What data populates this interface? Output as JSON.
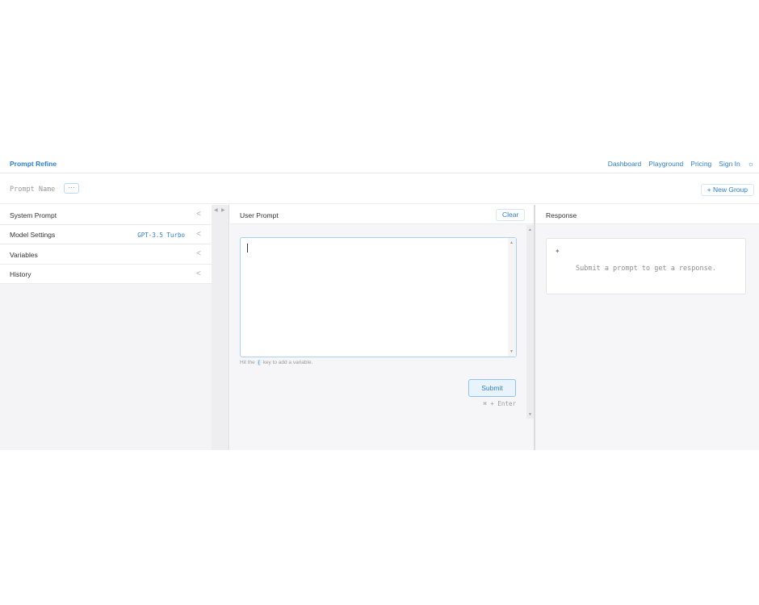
{
  "header": {
    "brand": "Prompt Refine",
    "nav": [
      "Dashboard",
      "Playground",
      "Pricing",
      "Sign In"
    ],
    "theme_icon": "sun-icon"
  },
  "name_row": {
    "prompt_name_placeholder": "Prompt Name",
    "more_label": "···",
    "new_group_label": "+ New Group"
  },
  "sidebar": {
    "items": [
      {
        "label": "System Prompt",
        "value": ""
      },
      {
        "label": "Model Settings",
        "value": "GPT-3.5 Turbo"
      },
      {
        "label": "Variables",
        "value": ""
      },
      {
        "label": "History",
        "value": ""
      }
    ],
    "chevron": "<"
  },
  "user_prompt": {
    "title": "User Prompt",
    "clear_label": "Clear",
    "input_value": "",
    "hint_before": "Hit the",
    "hint_key": "{",
    "hint_after": "key to add a variable.",
    "submit_label": "Submit",
    "shortcut": "⌘ + Enter"
  },
  "response": {
    "title": "Response",
    "icon": "sparkle-icon",
    "empty_message": "Submit a prompt to get a response."
  }
}
